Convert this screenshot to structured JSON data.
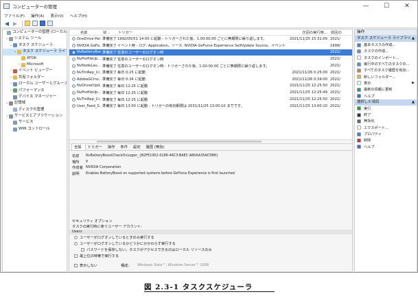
{
  "window": {
    "title": "コンピューターの管理"
  },
  "menu": [
    "ファイル(F)",
    "操作(A)",
    "表示(V)",
    "ヘルプ(H)"
  ],
  "toolbar_icons": [
    "back-arrow-icon",
    "forward-arrow-icon",
    "up-folder-icon",
    "properties-icon",
    "help-icon",
    "show-hide-icon"
  ],
  "tree": {
    "root": "コンピューターの管理 (ローカル)",
    "system_tools": "システム ツール",
    "task_scheduler": "タスク スケジューラ",
    "task_library": "タスク スケジューラ ライブ",
    "atok": "ATOK",
    "microsoft": "Microsoft",
    "event_viewer": "イベント ビューアー",
    "shared_folders": "共有フォルダー",
    "local_users": "ローカル ユーザーとグループ",
    "performance": "パフォーマンス",
    "device_manager": "デバイス マネージャー",
    "storage": "記憶域",
    "disk_mgmt": "ディスクの管理",
    "services_apps": "サービスとアプリケーション",
    "services": "サービス",
    "wmi": "WMI コントロール"
  },
  "columns": {
    "name": "名前",
    "status": "状...",
    "trigger": "トリガー",
    "next_run": "次回の実行時...",
    "last_run": "前回の"
  },
  "tasks": [
    {
      "name": "OneDrive Per...",
      "status": "準備完了",
      "trigger": "1992/05/01 14:00 に起動 - トリガーされた後、1.00:00:00 ごとに無期限に繰り返します。",
      "next_run": "2021/11/25 15:31:09",
      "last_run": "2021/"
    },
    {
      "name": "NVIDIA GeFo...",
      "status": "準備完了",
      "trigger": "イベント時 - ログ: Application、ソース: NVIDIA GeForce Experience SelfUpdate Source、イベント ID: 0",
      "next_run": "",
      "last_run": "1999/"
    },
    {
      "name": "NvBatteryBoo...",
      "status": "準備完了",
      "trigger": "任意のユーザーのログオン時",
      "next_run": "",
      "last_run": "2021/"
    },
    {
      "name": "NvProfileUp...",
      "status": "準備完了",
      "trigger": "任意のユーザーのログオン時",
      "next_run": "",
      "last_run": "2021/"
    },
    {
      "name": "NvNodeLau...",
      "status": "準備完了",
      "trigger": "任意のユーザーのログオン時 - トリガーされた後、1.00:00:00 ごとに無期限に繰り返します。",
      "next_run": "",
      "last_run": "2021/"
    },
    {
      "name": "NvTmRep_Cr...",
      "status": "準備完了",
      "trigger": "毎日 0:25 に起動",
      "next_run": "2021/11/26 0:25:00",
      "last_run": "2021/"
    },
    {
      "name": "AdobeGCInv...",
      "status": "準備完了",
      "trigger": "毎日 0:34 に起動",
      "next_run": "2021/11/26 0:34:00",
      "last_run": "2021/"
    },
    {
      "name": "NvDriverUpd...",
      "status": "準備完了",
      "trigger": "毎日 12:25 に起動",
      "next_run": "2021/11/25 12:25:50",
      "last_run": "2021/"
    },
    {
      "name": "NvProfileUp...",
      "status": "準備完了",
      "trigger": "毎日 12:25 に起動",
      "next_run": "2021/11/25 12:25:49",
      "last_run": "2021/"
    },
    {
      "name": "NvTmRep_Cr...",
      "status": "準備完了",
      "trigger": "毎日 12:25 に起動",
      "next_run": "2021/11/25 12:25:50",
      "last_run": "2021/"
    },
    {
      "name": "User_Feed_S...",
      "status": "準備完了",
      "trigger": "毎日 13:00 に起動 - トリガーの有効期限は 2031/11/25 13:00:10 までです。",
      "next_run": "2021/11/25 13:00:10",
      "last_run": "2021/"
    }
  ],
  "tabs": [
    "全般",
    "トリガー",
    "操作",
    "条件",
    "設定",
    "履歴 (無効)"
  ],
  "general": {
    "name_label": "名前",
    "name_value": "NvBatteryBoostCheckOnLogon_{B2FE1952-0186-46C3-BAEC-A80AA35AC5B8}",
    "location_label": "場所",
    "location_value": "¥",
    "author_label": "作成者",
    "author_value": "NVIDIA Corporation",
    "desc_label": "説明",
    "desc_value": "Enables BatteryBoost on supported systems before GeForce Experience is first launched"
  },
  "security": {
    "title": "セキュリティ オプション",
    "account_prompt": "タスクの実行時に使うユーザー アカウント:",
    "account": "Users",
    "opt_logged_on": "ユーザーがログオンしているときのみ実行する",
    "opt_whether": "ユーザーがログオンしているかどうかにかかわらず実行する",
    "opt_no_password": "パスワードを保存しない。タスクがアクセスできるのはローカル リソースのみ",
    "opt_highest": "最上位の特権で実行する",
    "hidden": "表示しない",
    "config_label": "構成:",
    "config_value": "Windows Vista™, Windows Server™ 2008"
  },
  "actions": {
    "header": "操作",
    "section1": "タスク スケジューラ ライブラリ",
    "items1": [
      {
        "label": "基本タスクの作成...",
        "icon": "create-basic-task-icon",
        "color": "#4a7ec8"
      },
      {
        "label": "タスクの作成...",
        "icon": "create-task-icon",
        "color": "#6b8fc2"
      },
      {
        "label": "タスクのインポート...",
        "icon": "import-icon",
        "color": "#ffffff"
      },
      {
        "label": "実行中のすべてのタスクの...",
        "icon": "running-tasks-icon",
        "color": "#5a8ad0"
      },
      {
        "label": "すべてのタスク履歴を有効...",
        "icon": "history-icon",
        "color": "#c08a3e"
      },
      {
        "label": "新しいフォルダー...",
        "icon": "new-folder-icon",
        "color": "#e8b84a"
      },
      {
        "label": "表示",
        "icon": "view-icon",
        "color": "#ffffff",
        "submenu": true
      },
      {
        "label": "最新の情報に更新",
        "icon": "refresh-icon",
        "color": "#3d9b5a"
      },
      {
        "label": "ヘルプ",
        "icon": "help-icon",
        "color": "#3a6fc4"
      }
    ],
    "section2": "選択した項目",
    "items2": [
      {
        "label": "実行",
        "icon": "run-icon",
        "color": "#2e9a3c"
      },
      {
        "label": "終了",
        "icon": "end-icon",
        "color": "#333333"
      },
      {
        "label": "無効化",
        "icon": "disable-icon",
        "color": "#666666"
      },
      {
        "label": "エクスポート...",
        "icon": "export-icon",
        "color": "#ffffff"
      },
      {
        "label": "プロパティ",
        "icon": "properties-icon",
        "color": "#4a7ec8"
      },
      {
        "label": "削除",
        "icon": "delete-icon",
        "color": "#d22d2d"
      },
      {
        "label": "ヘルプ",
        "icon": "help-icon",
        "color": "#3a6fc4"
      }
    ]
  },
  "caption": "図 2.3-1 タスクスケジューラ"
}
